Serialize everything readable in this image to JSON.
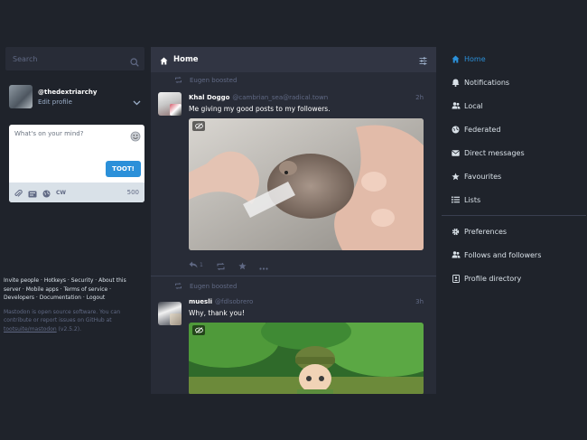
{
  "search": {
    "placeholder": "Search"
  },
  "account": {
    "handle": "@thedextriarchy",
    "edit_label": "Edit profile"
  },
  "compose": {
    "placeholder": "What's on your mind?",
    "cw_label": "CW",
    "char_count": "500",
    "toot_label": "TOOT!"
  },
  "footer": {
    "links": [
      "Invite people",
      "Hotkeys",
      "Security",
      "About this server",
      "Mobile apps",
      "Terms of service",
      "Developers",
      "Documentation",
      "Logout"
    ],
    "about_text": "Mastodon is open source software. You can contribute or report issues on GitHub at",
    "repo": "tootsuite/mastodon",
    "version": "(v2.5.2)."
  },
  "column": {
    "title": "Home"
  },
  "statuses": [
    {
      "boost_text": "Eugen boosted",
      "name": "Khal Doggo",
      "acct": "@cambrian_sea@radical.town",
      "time": "2h",
      "text": "Me giving my good posts to my followers.",
      "reply_count": "1"
    },
    {
      "boost_text": "Eugen boosted",
      "name": "muesli",
      "acct": "@fdlsobrero",
      "time": "3h",
      "text": "Why, thank you!"
    }
  ],
  "nav": {
    "primary": [
      {
        "label": "Home",
        "icon": "home-icon"
      },
      {
        "label": "Notifications",
        "icon": "bell-icon"
      },
      {
        "label": "Local",
        "icon": "users-icon"
      },
      {
        "label": "Federated",
        "icon": "globe-icon"
      },
      {
        "label": "Direct messages",
        "icon": "envelope-icon"
      },
      {
        "label": "Favourites",
        "icon": "star-icon"
      },
      {
        "label": "Lists",
        "icon": "list-icon"
      }
    ],
    "secondary": [
      {
        "label": "Preferences",
        "icon": "gear-icon"
      },
      {
        "label": "Follows and followers",
        "icon": "users-icon"
      },
      {
        "label": "Profile directory",
        "icon": "address-book-icon"
      }
    ]
  },
  "colors": {
    "accent": "#2b90d9",
    "background": "#1f232b",
    "column": "#282c37",
    "header": "#313543"
  }
}
